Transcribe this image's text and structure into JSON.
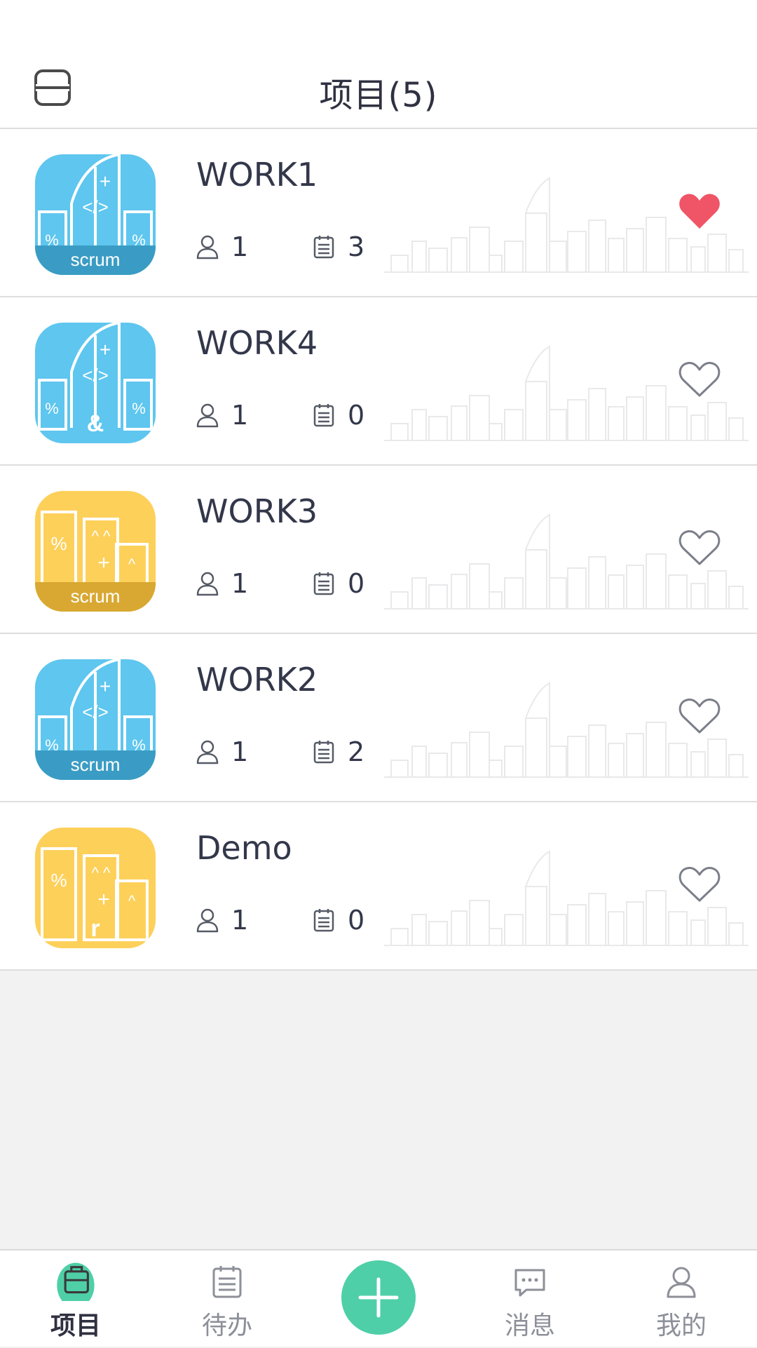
{
  "header": {
    "title": "项目(5)",
    "menu_icon": "scan-frame-icon"
  },
  "colors": {
    "accent": "#4ecfa8",
    "heart_active": "#ef5566",
    "blue_tile": "#5ec6ef",
    "blue_band": "#3a9cc4",
    "yellow_tile": "#fdd05a",
    "yellow_band": "#d8a832"
  },
  "projects": [
    {
      "name": "WORK1",
      "members": "1",
      "tasks": "3",
      "favorite": true,
      "icon": "blue-scrum-tile",
      "icon_text": "scrum"
    },
    {
      "name": "WORK4",
      "members": "1",
      "tasks": "0",
      "favorite": false,
      "icon": "blue-code-tile",
      "icon_text": "&"
    },
    {
      "name": "WORK3",
      "members": "1",
      "tasks": "0",
      "favorite": false,
      "icon": "yellow-scrum-tile",
      "icon_text": "scrum"
    },
    {
      "name": "WORK2",
      "members": "1",
      "tasks": "2",
      "favorite": false,
      "icon": "blue-scrum-tile",
      "icon_text": "scrum"
    },
    {
      "name": "Demo",
      "members": "1",
      "tasks": "0",
      "favorite": false,
      "icon": "yellow-code-tile",
      "icon_text": "r"
    }
  ],
  "tabs": [
    {
      "label": "项目",
      "icon": "briefcase-icon",
      "active": true
    },
    {
      "label": "待办",
      "icon": "clipboard-icon",
      "active": false
    },
    {
      "label": "消息",
      "icon": "chat-bubble-icon",
      "active": false
    },
    {
      "label": "我的",
      "icon": "user-icon",
      "active": false
    }
  ],
  "add_button": {
    "icon": "plus-icon"
  }
}
